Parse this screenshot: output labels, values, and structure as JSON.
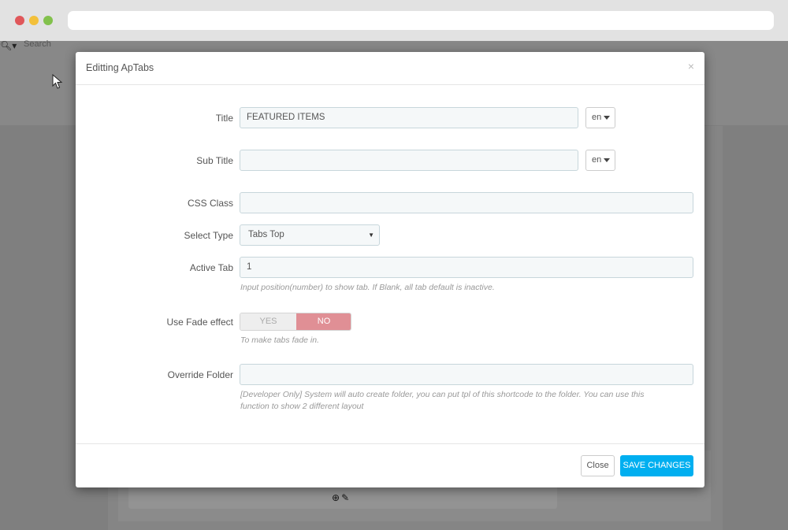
{
  "background": {
    "search_placeholder": "Search"
  },
  "modal": {
    "title": "Editting ApTabs",
    "close_symbol": "×",
    "fields": {
      "title": {
        "label": "Title",
        "value": "FEATURED ITEMS",
        "lang": "en"
      },
      "sub_title": {
        "label": "Sub Title",
        "value": "",
        "lang": "en"
      },
      "css_class": {
        "label": "CSS Class",
        "value": ""
      },
      "select_type": {
        "label": "Select Type",
        "value": "Tabs Top"
      },
      "active_tab": {
        "label": "Active Tab",
        "value": "1",
        "help": "Input position(number) to show tab. If Blank, all tab default is inactive."
      },
      "use_fade": {
        "label": "Use Fade effect",
        "yes": "YES",
        "no": "NO",
        "selected": "NO",
        "help": "To make tabs fade in."
      },
      "override_folder": {
        "label": "Override Folder",
        "value": "",
        "help_line1": "[Developer Only] System will auto create folder, you can put tpl of this shortcode to the folder. You can use this",
        "help_line2": "function to show 2 different layout"
      }
    },
    "footer": {
      "close_label": "Close",
      "save_label": "SAVE CHANGES"
    }
  },
  "colors": {
    "save_button": "#00aff0",
    "no_toggle_active": "#e08f95"
  }
}
